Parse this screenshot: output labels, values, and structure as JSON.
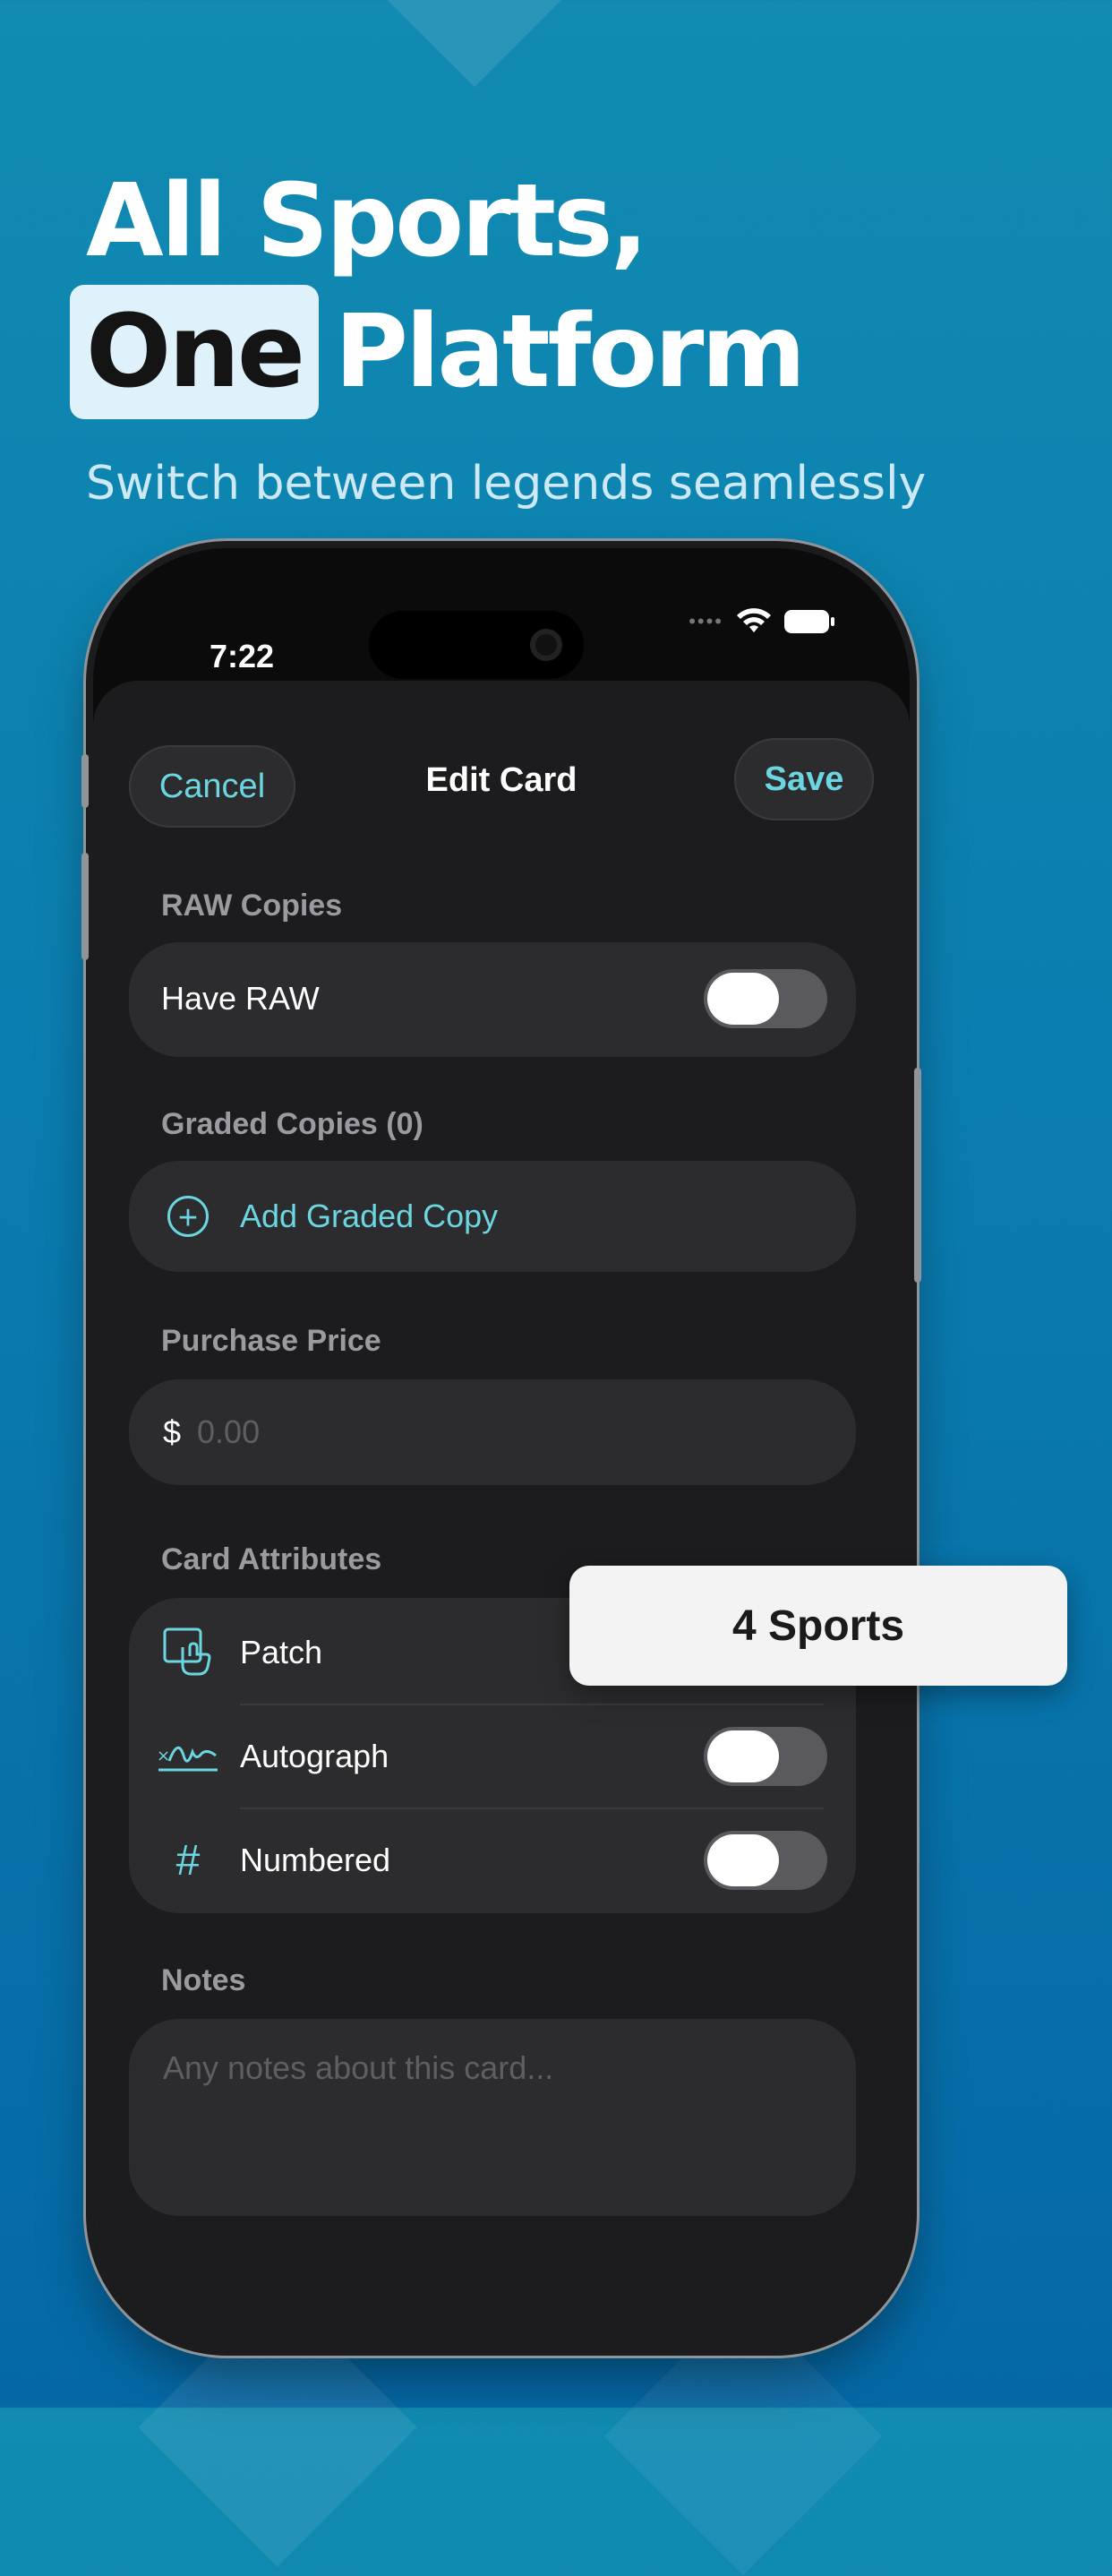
{
  "headline": {
    "line1": "All Sports,",
    "highlight": "One",
    "line2_rest": "Platform"
  },
  "subtitle": "Switch between legends seamlessly",
  "status_bar": {
    "time": "7:22"
  },
  "nav": {
    "cancel_label": "Cancel",
    "title": "Edit Card",
    "save_label": "Save"
  },
  "raw_copies": {
    "section_label": "RAW Copies",
    "have_raw_label": "Have RAW",
    "have_raw_on": false
  },
  "graded_copies": {
    "section_label": "Graded Copies (0)",
    "add_label": "Add Graded Copy"
  },
  "purchase_price": {
    "section_label": "Purchase Price",
    "currency": "$",
    "placeholder": "0.00"
  },
  "card_attributes": {
    "section_label": "Card Attributes",
    "items": [
      {
        "label": "Patch",
        "icon": "patch-icon"
      },
      {
        "label": "Autograph",
        "icon": "autograph-icon"
      },
      {
        "label": "Numbered",
        "icon": "hash-icon"
      }
    ]
  },
  "notes": {
    "section_label": "Notes",
    "placeholder": "Any notes about this card..."
  },
  "badge": {
    "label": "4 Sports"
  },
  "colors": {
    "accent": "#6bd6e0",
    "background_top": "#118bb1",
    "background_bottom": "#0568a5",
    "surface": "#2c2c2e"
  }
}
